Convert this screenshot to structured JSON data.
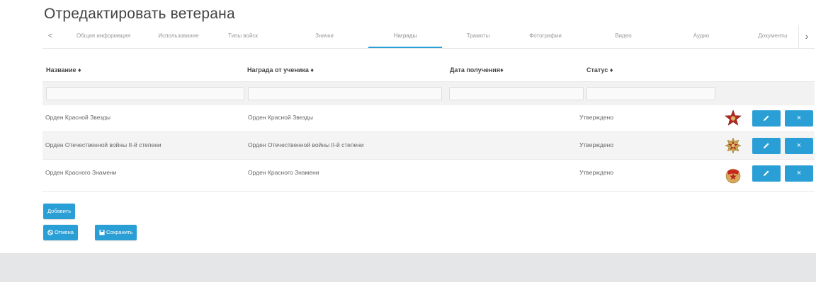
{
  "page": {
    "title": "Отредактировать ветерана"
  },
  "tabs": {
    "items": [
      "Общая информация",
      "Использование",
      "Типы войск",
      "Значки",
      "Награды",
      "Трамоты",
      "Фотографии",
      "Видео",
      "Аудио",
      "Документы"
    ],
    "active": "Награды",
    "prev_icon": "chevron-left-icon",
    "next_icon": "chevron-right-icon"
  },
  "table": {
    "headers": {
      "name": "Название ♦",
      "student_award": "Награда от ученика ♦",
      "date": "Дата получения♦",
      "status": "Статус ♦"
    },
    "rows": [
      {
        "name": "Орден Красной Звезды",
        "student_award": "Орден Красной Звезды",
        "date": "",
        "status": "Утверждено",
        "medal": "red-star-medal-icon"
      },
      {
        "name": "Орден Отечественной войны II-й степени",
        "student_award": "Орден Отечественной войны II-й степени",
        "date": "",
        "status": "Утверждено",
        "medal": "patriotic-war-order-icon"
      },
      {
        "name": "Орден Красного Знамени",
        "student_award": "Орден Красного Знамени",
        "date": "",
        "status": "Утверждено",
        "medal": "red-banner-order-icon"
      }
    ],
    "edit_icon": "pencil-icon",
    "delete_icon": "close-icon"
  },
  "actions": {
    "add": "Добавить",
    "cancel": "Отмена",
    "save": "Сохранить"
  },
  "colors": {
    "accent": "#2a9fd6",
    "footer": "#e5e6e8"
  }
}
